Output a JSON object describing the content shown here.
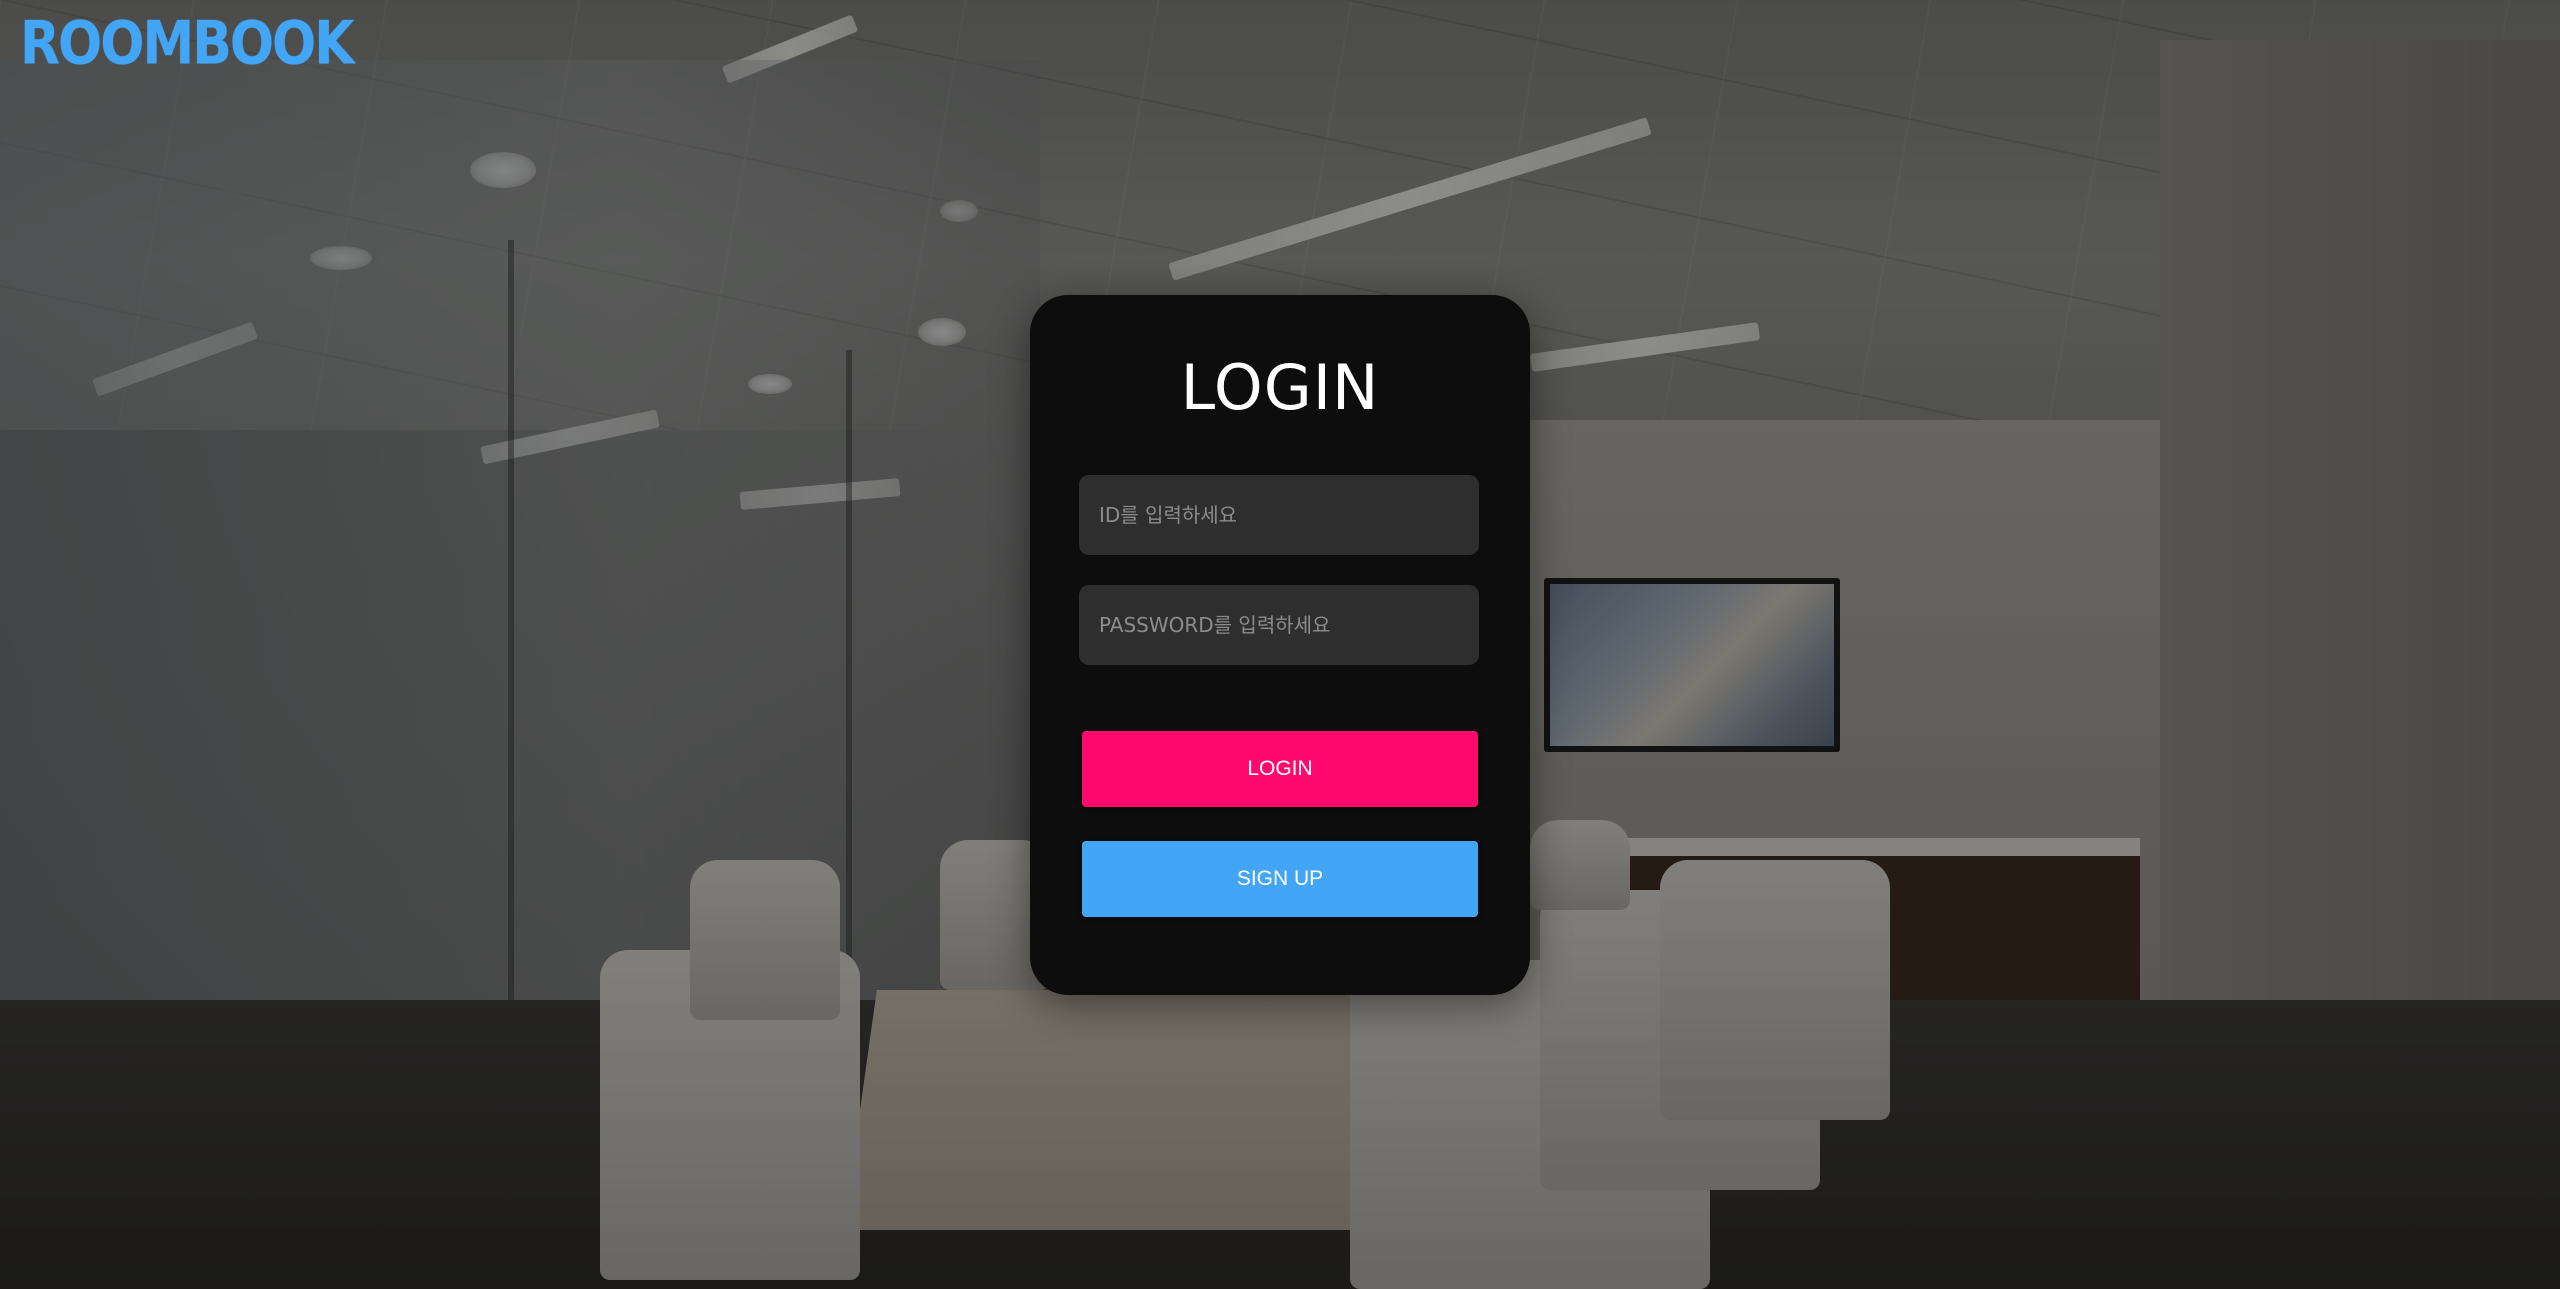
{
  "brand": {
    "logo_text": "ROOMBOOK",
    "accent_color": "#42a5f5"
  },
  "login_form": {
    "title": "LOGIN",
    "id_placeholder": "ID를 입력하세요",
    "password_placeholder": "PASSWORD를 입력하세요",
    "login_button": "LOGIN",
    "signup_button": "SIGN UP",
    "login_button_color": "#ff0a6c",
    "signup_button_color": "#42a5f5",
    "card_color": "#0d0d0d"
  }
}
